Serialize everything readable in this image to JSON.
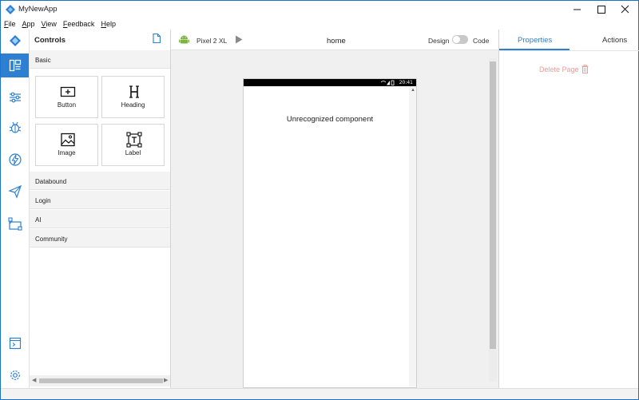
{
  "window": {
    "title": "MyNewApp",
    "accent_color": "#2c7fd1"
  },
  "menu": [
    {
      "key": "F",
      "rest": "ile"
    },
    {
      "key": "A",
      "rest": "pp"
    },
    {
      "key": "V",
      "rest": "iew"
    },
    {
      "key": "F",
      "rest": "eedback"
    },
    {
      "key": "H",
      "rest": "elp"
    }
  ],
  "rail": {
    "items": [
      {
        "name": "controls-icon",
        "active": true
      },
      {
        "name": "sliders-icon",
        "active": false
      },
      {
        "name": "bug-icon",
        "active": false
      },
      {
        "name": "lightning-icon",
        "active": false
      },
      {
        "name": "send-icon",
        "active": false
      },
      {
        "name": "flow-icon",
        "active": false
      }
    ],
    "bottom": [
      "terminal-icon",
      "gear-icon"
    ]
  },
  "controls": {
    "title": "Controls",
    "basic_label": "Basic",
    "tiles": [
      {
        "label": "Button",
        "icon": "button-icon"
      },
      {
        "label": "Heading",
        "icon": "heading-icon"
      },
      {
        "label": "Image",
        "icon": "image-icon"
      },
      {
        "label": "Label",
        "icon": "label-icon"
      }
    ],
    "sections": [
      "Databound",
      "Login",
      "AI",
      "Community"
    ]
  },
  "canvas": {
    "device": "Pixel 2 XL",
    "page_name": "home",
    "design_label": "Design",
    "code_label": "Code",
    "phone_clock": "20:41",
    "message": "Unrecognized component"
  },
  "properties": {
    "tab_properties": "Properties",
    "tab_actions": "Actions",
    "delete_label": "Delete Page"
  }
}
